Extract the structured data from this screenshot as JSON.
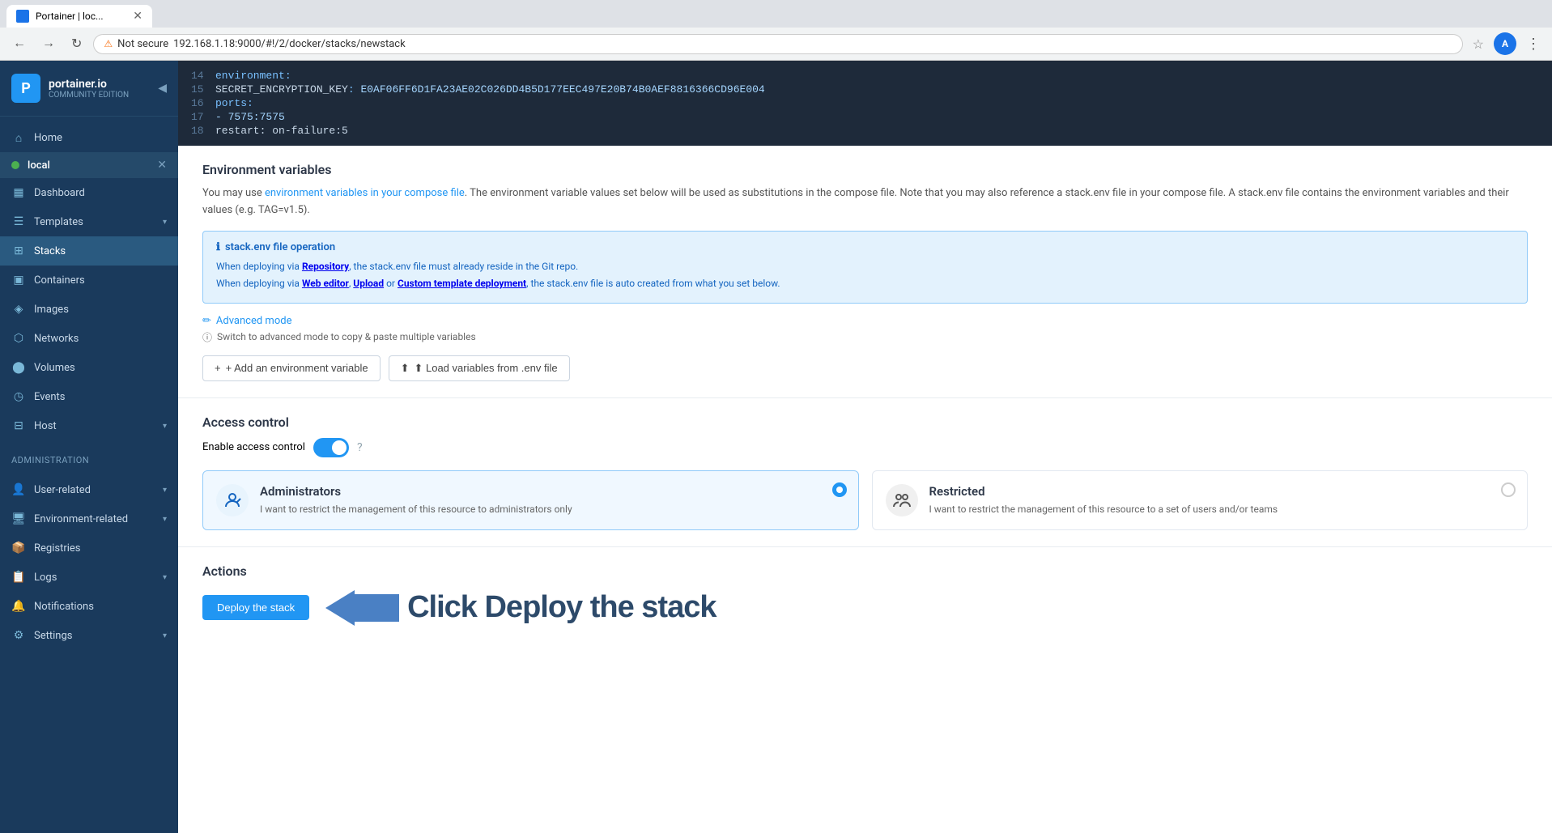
{
  "browser": {
    "tab_title": "Portainer | loc...",
    "address": "192.168.1.18:9000/#!/2/docker/stacks/newstack",
    "security_label": "Not secure",
    "favicon_letter": "P"
  },
  "sidebar": {
    "logo_letter": "P",
    "logo_main": "portainer.io",
    "logo_sub": "COMMUNITY EDITION",
    "collapse_icon": "◀",
    "env_label": "local",
    "items": [
      {
        "id": "home",
        "label": "Home",
        "icon": "⌂"
      },
      {
        "id": "dashboard",
        "label": "Dashboard",
        "icon": "▦"
      },
      {
        "id": "templates",
        "label": "Templates",
        "icon": "☰",
        "has_arrow": true
      },
      {
        "id": "stacks",
        "label": "Stacks",
        "icon": "⊞",
        "active": true
      },
      {
        "id": "containers",
        "label": "Containers",
        "icon": "▣"
      },
      {
        "id": "images",
        "label": "Images",
        "icon": "◈"
      },
      {
        "id": "networks",
        "label": "Networks",
        "icon": "⬡"
      },
      {
        "id": "volumes",
        "label": "Volumes",
        "icon": "⬤"
      },
      {
        "id": "events",
        "label": "Events",
        "icon": "◷"
      },
      {
        "id": "host",
        "label": "Host",
        "icon": "⊟",
        "has_arrow": true
      }
    ],
    "admin_section": "Administration",
    "admin_items": [
      {
        "id": "user-related",
        "label": "User-related",
        "icon": "👤",
        "has_arrow": true
      },
      {
        "id": "environment-related",
        "label": "Environment-related",
        "icon": "🖥",
        "has_arrow": true
      },
      {
        "id": "registries",
        "label": "Registries",
        "icon": "📦"
      },
      {
        "id": "logs",
        "label": "Logs",
        "icon": "📋",
        "has_arrow": true
      },
      {
        "id": "notifications",
        "label": "Notifications",
        "icon": "🔔"
      },
      {
        "id": "settings",
        "label": "Settings",
        "icon": "⚙",
        "has_arrow": true
      }
    ]
  },
  "code_editor": {
    "lines": [
      {
        "num": "14",
        "content": "  environment:",
        "type": "key"
      },
      {
        "num": "15",
        "content": "    SECRET_ENCRYPTION_KEY: E0AF06FF6D1FA23AE02C026DD4B5D177EEC497E20B74B0AEF8816366CD96E004",
        "type": "key_value"
      },
      {
        "num": "16",
        "content": "  ports:",
        "type": "key"
      },
      {
        "num": "17",
        "content": "    - 7575:7575",
        "type": "value"
      },
      {
        "num": "18",
        "content": "  restart: on-failure:5",
        "type": "key_value"
      }
    ]
  },
  "env_variables": {
    "section_title": "Environment variables",
    "desc_before_link": "You may use ",
    "desc_link": "environment variables in your compose file",
    "desc_after": ". The environment variable values set below will be used as substitutions in the compose file. Note that you may also reference a stack.env file in your compose file. A stack.env file contains the environment variables and their values (e.g. TAG=v1.5).",
    "info_title": "stack.env file operation",
    "info_line1_before": "When deploying via ",
    "info_line1_link": "Repository",
    "info_line1_after": ", the stack.env file must already reside in the Git repo.",
    "info_line2_before": "When deploying via ",
    "info_line2_link1": "Web editor",
    "info_line2_sep1": ", ",
    "info_line2_link2": "Upload",
    "info_line2_sep2": " or ",
    "info_line2_link3": "Custom template deployment",
    "info_line2_after": ", the stack.env file is auto created from what you set below.",
    "advanced_mode_label": "Advanced mode",
    "advanced_mode_sub": "Switch to advanced mode to copy & paste multiple variables",
    "add_btn": "+ Add an environment variable",
    "load_btn": "⬆ Load variables from .env file"
  },
  "access_control": {
    "section_title": "Access control",
    "enable_label": "Enable access control",
    "toggle_on": true,
    "cards": [
      {
        "id": "administrators",
        "title": "Administrators",
        "desc": "I want to restrict the management of this resource to administrators only",
        "icon": "🚫",
        "selected": true
      },
      {
        "id": "restricted",
        "title": "Restricted",
        "desc": "I want to restrict the management of this resource to a set of users and/or teams",
        "icon": "👥",
        "selected": false
      }
    ]
  },
  "actions": {
    "section_title": "Actions",
    "deploy_btn": "Deploy the stack",
    "annotation_text": "Click Deploy the stack"
  }
}
